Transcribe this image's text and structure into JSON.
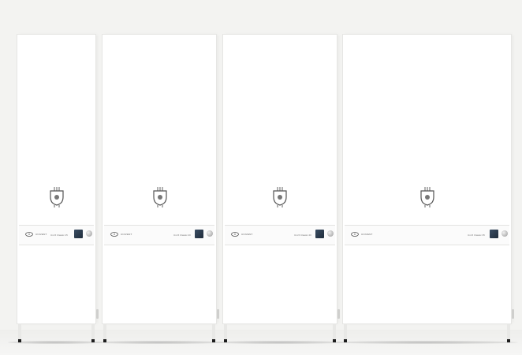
{
  "cabinets": [
    {
      "brand": "UNIVENT",
      "model": "Uni-5 Classic 15"
    },
    {
      "brand": "UNIVENT",
      "model": "Uni-5 Classic 20"
    },
    {
      "brand": "UNIVENT",
      "model": "Uni-5 Classic 20"
    },
    {
      "brand": "UNIVENT",
      "model": "Uni-5 Classic 35"
    }
  ],
  "icons": {
    "unit": "heat-exchanger-icon",
    "logo": "univent-logo-icon",
    "display": "control-display",
    "knob": "control-knob"
  },
  "colors": {
    "cabinet": "#ffffff",
    "background": "#f3f3f1",
    "display": "#2b3a4c",
    "feet": "#1e1e1e"
  }
}
